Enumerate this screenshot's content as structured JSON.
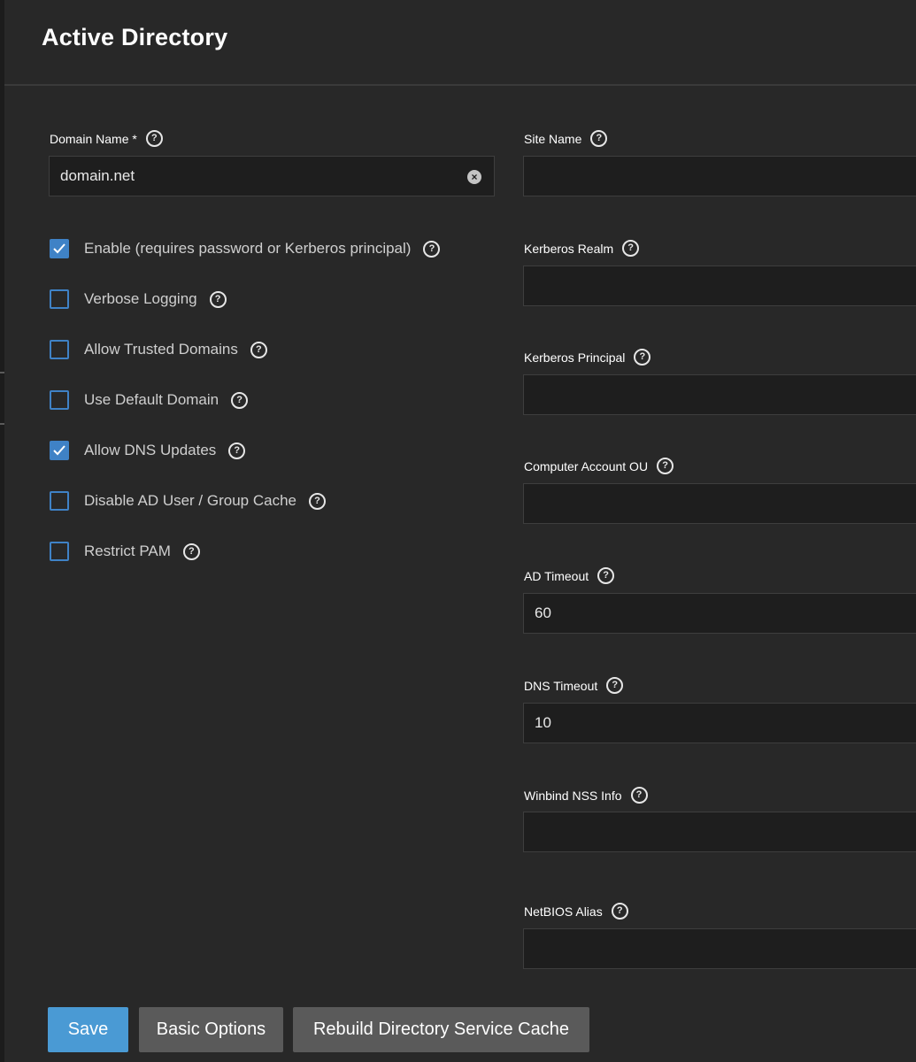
{
  "header": {
    "title": "Active Directory"
  },
  "left": {
    "domain_name": {
      "label": "Domain Name",
      "required_mark": "*",
      "value": "domain.net"
    },
    "checkboxes": [
      {
        "label": "Enable (requires password or Kerberos principal)",
        "checked": true
      },
      {
        "label": "Verbose Logging",
        "checked": false
      },
      {
        "label": "Allow Trusted Domains",
        "checked": false
      },
      {
        "label": "Use Default Domain",
        "checked": false
      },
      {
        "label": "Allow DNS Updates",
        "checked": true
      },
      {
        "label": "Disable AD User / Group Cache",
        "checked": false
      },
      {
        "label": "Restrict PAM",
        "checked": false
      }
    ]
  },
  "right": {
    "fields": [
      {
        "label": "Site Name",
        "value": ""
      },
      {
        "label": "Kerberos Realm",
        "value": ""
      },
      {
        "label": "Kerberos Principal",
        "value": ""
      },
      {
        "label": "Computer Account OU",
        "value": ""
      },
      {
        "label": "AD Timeout",
        "value": "60"
      },
      {
        "label": "DNS Timeout",
        "value": "10"
      },
      {
        "label": "Winbind NSS Info",
        "value": ""
      },
      {
        "label": "NetBIOS Alias",
        "value": ""
      }
    ]
  },
  "actions": {
    "save": "Save",
    "basic_options": "Basic Options",
    "rebuild_cache": "Rebuild Directory Service Cache"
  },
  "icons": {
    "help": "help-icon",
    "clear": "clear-icon",
    "check": "checkmark-icon"
  },
  "colors": {
    "accent": "#3f82c6",
    "primary_button": "#4a9ad4",
    "background": "#282828"
  }
}
